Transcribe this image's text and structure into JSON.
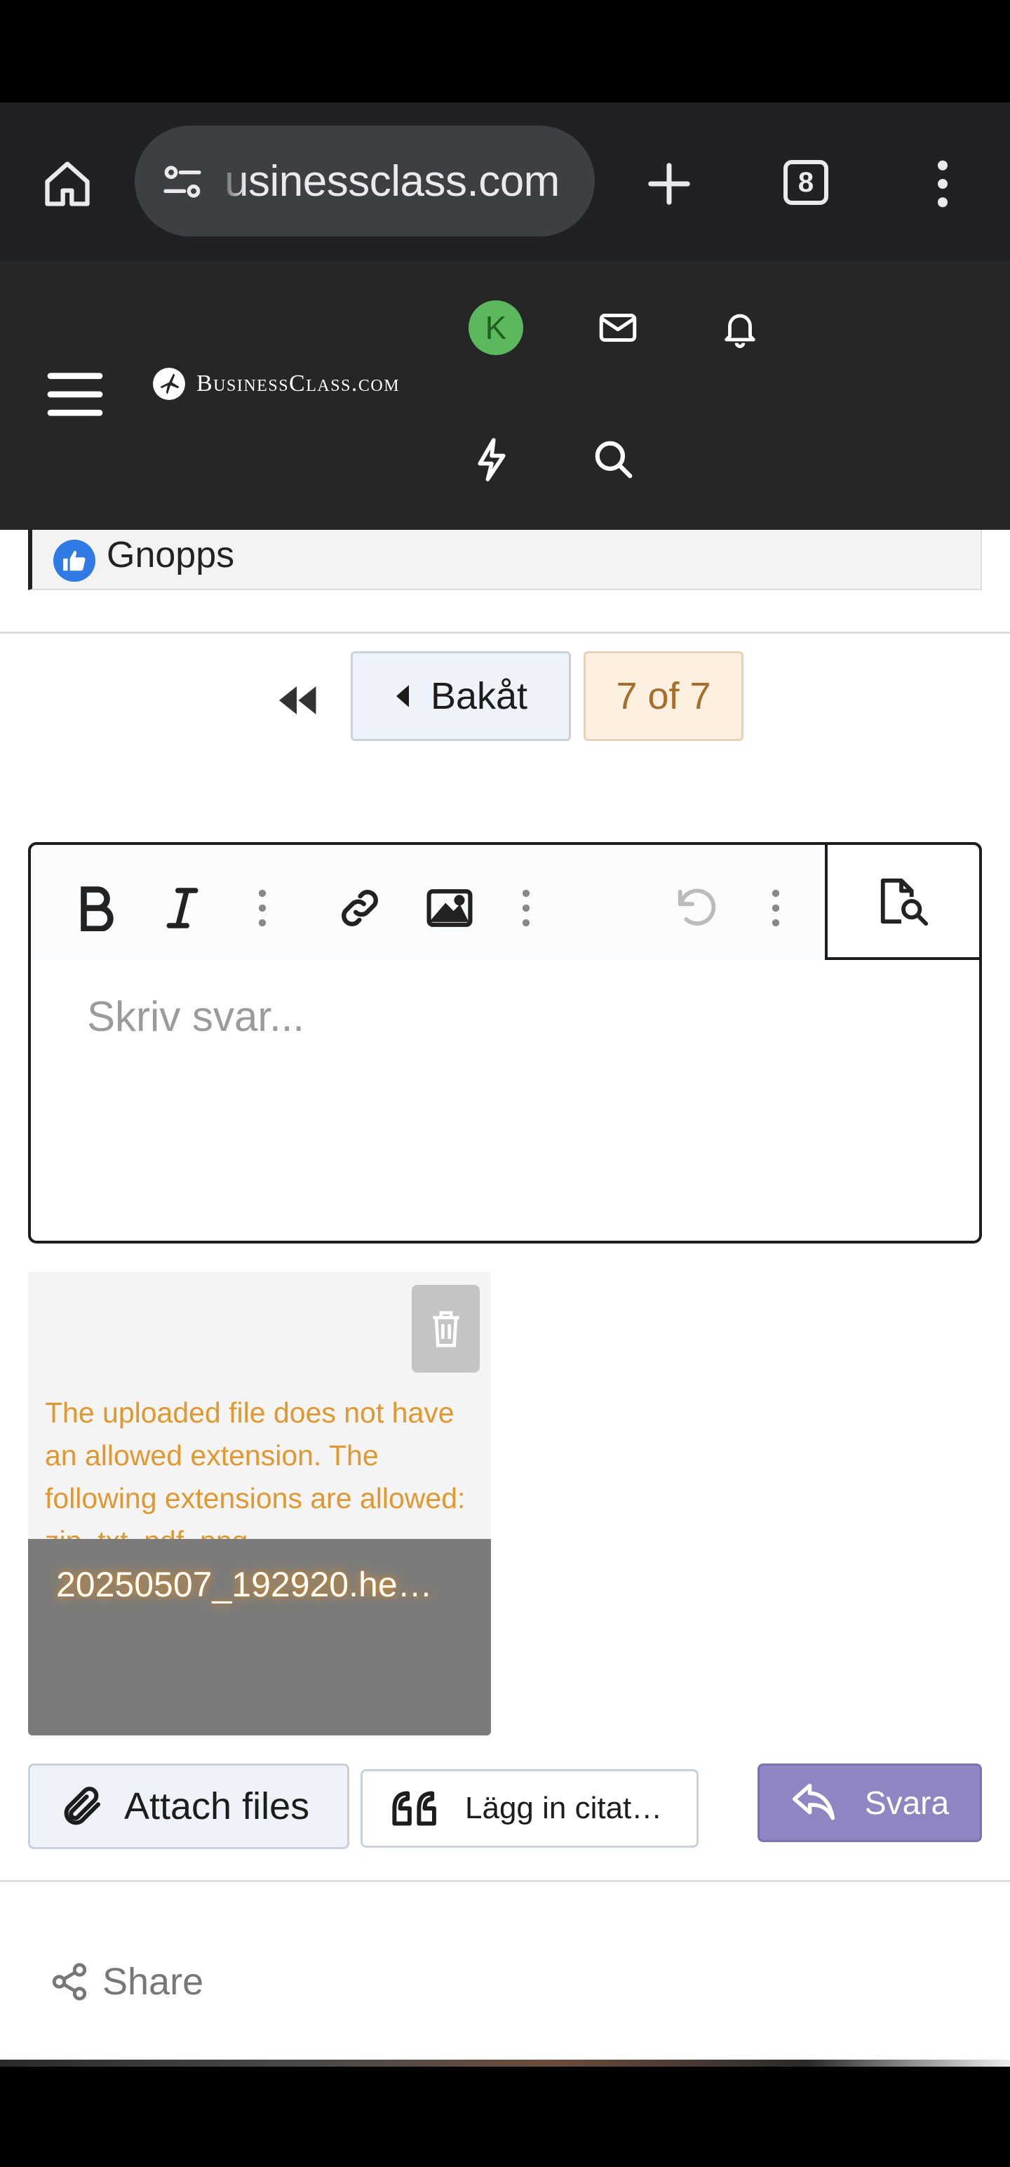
{
  "browser": {
    "url": "usinessclass.com",
    "tab_count": "8"
  },
  "site": {
    "logo_text": "BusinessClass.com",
    "user_initial": "K"
  },
  "reaction": {
    "name": "Gnopps"
  },
  "pagination": {
    "back_label": "Bakåt",
    "page_label": "7 of 7"
  },
  "editor": {
    "placeholder": "Skriv svar..."
  },
  "attachment": {
    "error": "The uploaded file does not have an allowed extension. The following extensions are allowed: zip, txt, pdf, png",
    "file_name": "20250507_192920.he…"
  },
  "actions": {
    "attach_label": "Attach files",
    "quote_label": "Lägg in citat…",
    "reply_label": "Svara",
    "share_label": "Share"
  },
  "colors": {
    "reply_button": "#8d86c3",
    "page_indicator": "#a86d2a",
    "error_text": "#e0982f",
    "avatar": "#5cb85c"
  }
}
